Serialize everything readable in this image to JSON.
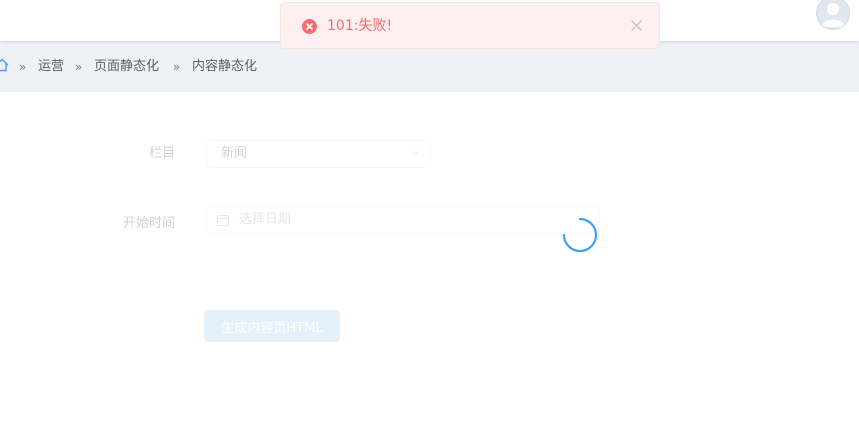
{
  "toast": {
    "message": "101:失败!"
  },
  "breadcrumb": {
    "items": [
      "运营",
      "页面静态化",
      "内容静态化"
    ],
    "separator": "»"
  },
  "form": {
    "column_label": "栏目",
    "column_value": "新闻",
    "start_time_label": "开始时间",
    "date_placeholder": "选择日期",
    "generate_button_label": "生成内容页HTML"
  },
  "colors": {
    "error": "#f56c6c",
    "primary": "#409eff",
    "breadcrumb_bg": "#eef1f6"
  },
  "icons": [
    "home-icon",
    "error-circle-icon",
    "close-icon",
    "chevron-down-icon",
    "calendar-icon",
    "loading-spinner-icon",
    "avatar-icon"
  ]
}
